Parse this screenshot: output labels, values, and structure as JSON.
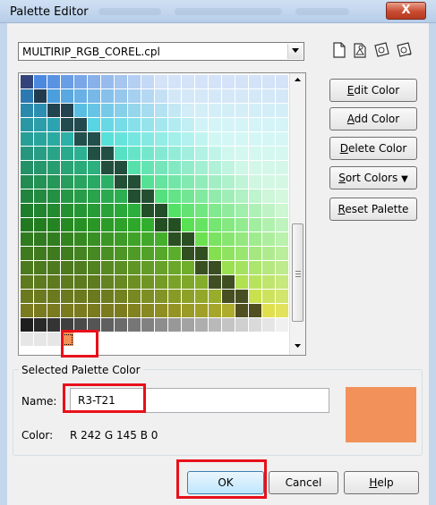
{
  "window": {
    "title": "Palette Editor",
    "close_glyph": "X"
  },
  "palette_file": {
    "value": "MULTIRIP_RGB_COREL.cpl"
  },
  "toolbar_icons": [
    "new-palette-icon",
    "open-palette-icon",
    "save-palette-icon",
    "save-as-palette-icon"
  ],
  "buttons": {
    "edit_color": {
      "accel": "E",
      "rest": "dit Color"
    },
    "add_color": {
      "accel": "A",
      "rest": "dd Color"
    },
    "delete_color": {
      "accel": "D",
      "rest": "elete Color"
    },
    "sort_colors": {
      "accel": "S",
      "rest": "ort Colors",
      "arrow": "▼"
    },
    "reset_palette": {
      "accel": "R",
      "rest": "eset Palette"
    },
    "ok": "OK",
    "cancel": "Cancel",
    "help": {
      "accel": "H",
      "rest": "elp"
    }
  },
  "selected_group": {
    "title": "Selected Palette Color",
    "name_label": "Name:",
    "name_value": "R3-T21",
    "color_label": "Color:",
    "color_value": "R  242  G  145  B  0",
    "swatch_color": "#f29159"
  },
  "colors": {
    "accent_red": "#e8101a"
  }
}
